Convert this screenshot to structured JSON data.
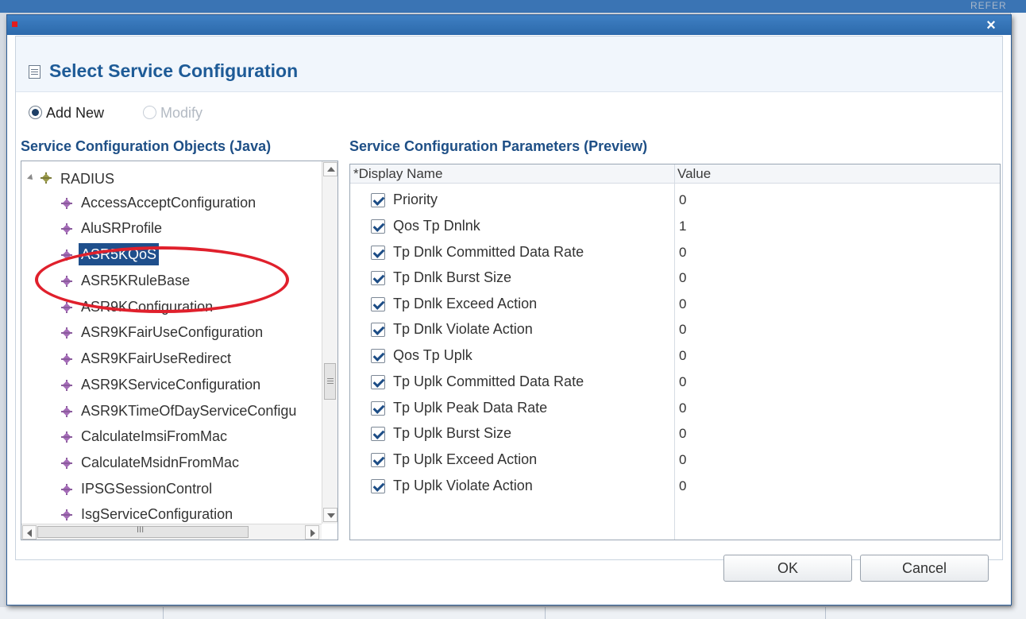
{
  "background": {
    "corner_text": "REFER"
  },
  "dialog": {
    "close_glyph": "×",
    "title": "Select Service Configuration",
    "mode": {
      "add_new_label": "Add New",
      "modify_label": "Modify",
      "selected": "Add New"
    },
    "left_section_title": "Service Configuration Objects (Java)",
    "right_section_title": "Service Configuration Parameters (Preview)",
    "tree": {
      "root_label": "RADIUS",
      "items": [
        "AccessAcceptConfiguration",
        "AluSRProfile",
        "ASR5KQoS",
        "ASR5KRuleBase",
        "ASR9KConfiguration",
        "ASR9KFairUseConfiguration",
        "ASR9KFairUseRedirect",
        "ASR9KServiceConfiguration",
        "ASR9KTimeOfDayServiceConfigu",
        "CalculateImsiFromMac",
        "CalculateMsidnFromMac",
        "IPSGSessionControl",
        "IsgServiceConfiguration"
      ],
      "selected": "ASR5KQoS",
      "hscroll_thumb_glyph": "III"
    },
    "params": {
      "columns": [
        "*Display Name",
        "Value"
      ],
      "rows": [
        {
          "name": "Priority",
          "value": "0",
          "checked": true
        },
        {
          "name": "Qos Tp Dnlnk",
          "value": "1",
          "checked": true
        },
        {
          "name": "Tp Dnlk Committed Data Rate",
          "value": "0",
          "checked": true
        },
        {
          "name": "Tp Dnlk Burst Size",
          "value": "0",
          "checked": true
        },
        {
          "name": "Tp Dnlk Exceed Action",
          "value": "0",
          "checked": true
        },
        {
          "name": "Tp Dnlk Violate Action",
          "value": "0",
          "checked": true
        },
        {
          "name": "Qos Tp Uplk",
          "value": "0",
          "checked": true
        },
        {
          "name": "Tp Uplk Committed Data Rate",
          "value": "0",
          "checked": true
        },
        {
          "name": "Tp Uplk Peak Data Rate",
          "value": "0",
          "checked": true
        },
        {
          "name": "Tp Uplk Burst Size",
          "value": "0",
          "checked": true
        },
        {
          "name": "Tp Uplk Exceed Action",
          "value": "0",
          "checked": true
        },
        {
          "name": "Tp Uplk Violate Action",
          "value": "0",
          "checked": true
        }
      ]
    },
    "buttons": {
      "ok": "OK",
      "cancel": "Cancel"
    }
  },
  "colors": {
    "titlebar": "#3374b8",
    "accent_text": "#1e5b97",
    "selection": "#1f4f8c",
    "annotation_ring": "#e0202c"
  }
}
